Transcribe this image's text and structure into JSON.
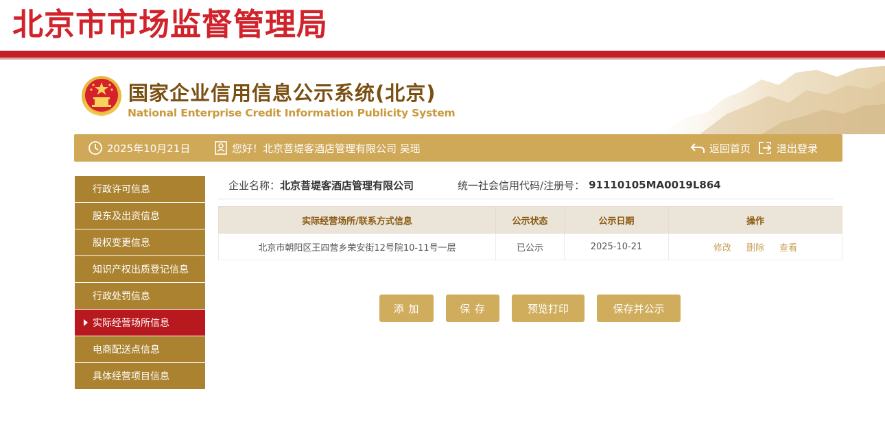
{
  "agency": {
    "title": "北京市市场监督管理局"
  },
  "system": {
    "title_cn": "国家企业信用信息公示系统(北京)",
    "title_en": "National Enterprise Credit Information Publicity System"
  },
  "navbar": {
    "date": "2025年10月21日",
    "greeting": "您好！北京菩堤客酒店管理有限公司 吴瑶",
    "home_label": "返回首页",
    "logout_label": "退出登录"
  },
  "sidebar": {
    "items": [
      {
        "label": "行政许可信息"
      },
      {
        "label": "股东及出资信息"
      },
      {
        "label": "股权变更信息"
      },
      {
        "label": "知识产权出质登记信息"
      },
      {
        "label": "行政处罚信息"
      },
      {
        "label": "实际经营场所信息",
        "active": true
      },
      {
        "label": "电商配送点信息"
      },
      {
        "label": "具体经营项目信息"
      }
    ]
  },
  "company": {
    "name_label": "企业名称：",
    "name": "北京菩堤客酒店管理有限公司",
    "code_label": "统一社会信用代码/注册号：",
    "code": "91110105MA0019L864"
  },
  "table": {
    "headers": [
      "实际经营场所/联系方式信息",
      "公示状态",
      "公示日期",
      "操作"
    ],
    "rows": [
      {
        "address": "北京市朝阳区王四营乡荣安街12号院10-11号一层",
        "status": "已公示",
        "date": "2025-10-21",
        "actions": [
          "修改",
          "删除",
          "查看"
        ]
      }
    ]
  },
  "buttons": {
    "add": "添 加",
    "save": "保 存",
    "preview": "预览打印",
    "save_publish": "保存并公示"
  },
  "colors": {
    "brand_red": "#c41f26",
    "gold": "#cfa858",
    "sidebar_gold": "#ab822f",
    "active_red": "#b8191f"
  },
  "icons": {
    "date": "clock-icon",
    "greeting": "user-badge-icon",
    "home": "return-arrow-icon",
    "logout": "logout-icon"
  }
}
